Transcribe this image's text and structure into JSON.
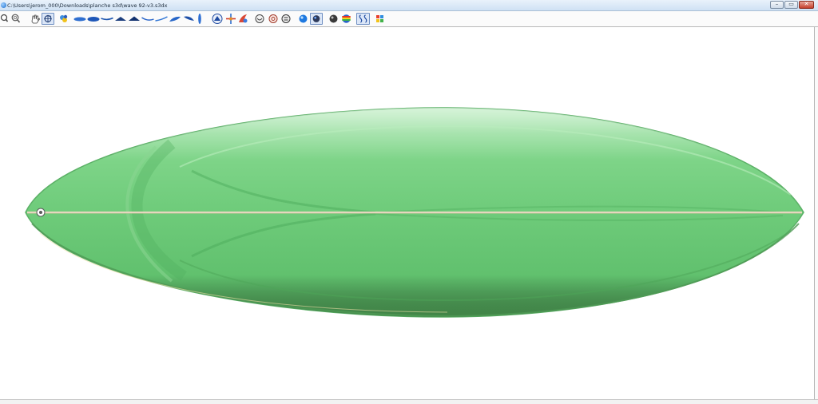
{
  "window": {
    "title": "C:\\Users\\jerom_000\\Downloads\\planche s3d\\wave 92-v3.s3dx",
    "minimize_glyph": "–",
    "maximize_glyph": "▭",
    "close_glyph": "✕"
  },
  "toolbar": {
    "tools": [
      {
        "name": "zoom-in-icon"
      },
      {
        "name": "zoom-out-icon"
      },
      {
        "name": "pan-hand-icon"
      },
      {
        "name": "rotate-icon",
        "selected": true
      },
      {
        "name": "color-palette-icon"
      },
      {
        "name": "view-top-icon"
      },
      {
        "name": "view-bottom-icon"
      },
      {
        "name": "view-rocker-icon"
      },
      {
        "name": "view-side-icon"
      },
      {
        "name": "view-slice-icon"
      },
      {
        "name": "view-outline-icon"
      },
      {
        "name": "view-deck-icon"
      },
      {
        "name": "view-3d-icon"
      },
      {
        "name": "view-fins-icon"
      },
      {
        "name": "view-stringer-icon"
      },
      {
        "name": "board-shape-icon"
      },
      {
        "name": "axes-icon"
      },
      {
        "name": "fin-icon"
      },
      {
        "name": "render-icon"
      },
      {
        "name": "face-icon-1"
      },
      {
        "name": "face-icon-2"
      },
      {
        "name": "face-icon-3"
      },
      {
        "name": "sphere-blue-icon"
      },
      {
        "name": "sphere-dark-icon",
        "selected": true
      },
      {
        "name": "sphere-black-icon"
      },
      {
        "name": "rainbow-icon"
      },
      {
        "name": "curvature-icon",
        "selected": true
      },
      {
        "name": "grid-colors-icon"
      }
    ]
  },
  "viewport": {
    "background": "#ffffff",
    "board_color": "#6fcd7c",
    "stringer_color": "#e7d6be"
  }
}
